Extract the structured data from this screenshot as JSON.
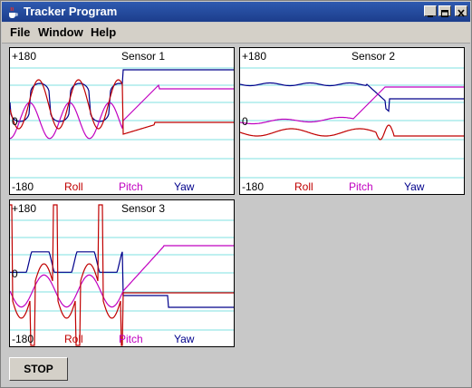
{
  "window": {
    "title": "Tracker Program",
    "icon": "java-cup-icon"
  },
  "menu": {
    "items": [
      "File",
      "Window",
      "Help"
    ]
  },
  "colors": {
    "roll": "#c00000",
    "pitch": "#c000c0",
    "yaw": "#00008b",
    "grid": "#7fe0e0"
  },
  "sensors": [
    {
      "title": "Sensor 1",
      "max_label": "+180",
      "zero_label": "0",
      "min_label": "-180",
      "legend": {
        "roll": "Roll",
        "pitch": "Pitch",
        "yaw": "Yaw"
      }
    },
    {
      "title": "Sensor 2",
      "max_label": "+180",
      "zero_label": "0",
      "min_label": "-180",
      "legend": {
        "roll": "Roll",
        "pitch": "Pitch",
        "yaw": "Yaw"
      }
    },
    {
      "title": "Sensor 3",
      "max_label": "+180",
      "zero_label": "0",
      "min_label": "-180",
      "legend": {
        "roll": "Roll",
        "pitch": "Pitch",
        "yaw": "Yaw"
      }
    }
  ],
  "controls": {
    "stop_label": "STOP"
  }
}
